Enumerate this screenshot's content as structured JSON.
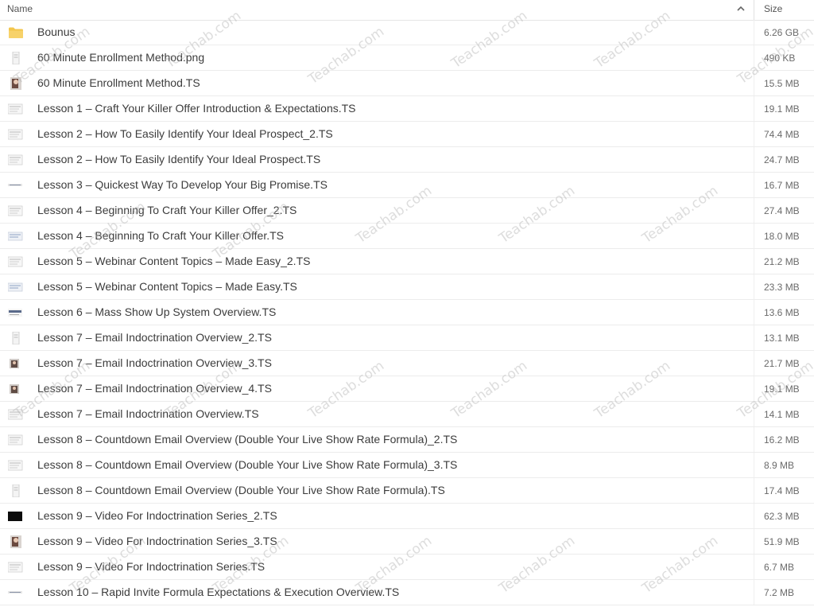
{
  "header": {
    "name_label": "Name",
    "size_label": "Size",
    "sort_icon": "chevron-up-icon"
  },
  "watermark": "Teachab.com",
  "files": [
    {
      "name": "Bounus",
      "size": "6.26 GB",
      "icon": "folder-icon",
      "kind": "folder"
    },
    {
      "name": "60 Minute Enrollment Method.png",
      "size": "490 KB",
      "icon": "image-thumb-icon",
      "kind": "doc-narrow"
    },
    {
      "name": "60 Minute Enrollment Method.TS",
      "size": "15.5 MB",
      "icon": "video-thumb-icon",
      "kind": "photo"
    },
    {
      "name": "Lesson 1 – Craft Your Killer Offer Introduction & Expectations.TS",
      "size": "19.1 MB",
      "icon": "video-thumb-icon",
      "kind": "slide"
    },
    {
      "name": "Lesson 2 – How To Easily Identify Your Ideal Prospect_2.TS",
      "size": "74.4 MB",
      "icon": "video-thumb-icon",
      "kind": "slide"
    },
    {
      "name": "Lesson 2 – How To Easily Identify Your Ideal Prospect.TS",
      "size": "24.7 MB",
      "icon": "video-thumb-icon",
      "kind": "slide"
    },
    {
      "name": "Lesson 3 – Quickest Way To Develop Your Big Promise.TS",
      "size": "16.7 MB",
      "icon": "video-thumb-icon",
      "kind": "line"
    },
    {
      "name": "Lesson 4 – Beginning To Craft Your Killer Offer_2.TS",
      "size": "27.4 MB",
      "icon": "video-thumb-icon",
      "kind": "slide"
    },
    {
      "name": "Lesson 4 – Beginning To Craft Your Killer Offer.TS",
      "size": "18.0 MB",
      "icon": "video-thumb-icon",
      "kind": "slide-blue"
    },
    {
      "name": "Lesson 5 – Webinar Content Topics – Made Easy_2.TS",
      "size": "21.2 MB",
      "icon": "video-thumb-icon",
      "kind": "slide"
    },
    {
      "name": "Lesson 5 – Webinar Content Topics – Made Easy.TS",
      "size": "23.3 MB",
      "icon": "video-thumb-icon",
      "kind": "slide-blue"
    },
    {
      "name": "Lesson 6 – Mass Show Up System Overview.TS",
      "size": "13.6 MB",
      "icon": "video-thumb-icon",
      "kind": "text"
    },
    {
      "name": "Lesson 7 – Email Indoctrination Overview_2.TS",
      "size": "13.1 MB",
      "icon": "video-thumb-icon",
      "kind": "doc-narrow"
    },
    {
      "name": "Lesson 7 – Email Indoctrination Overview_3.TS",
      "size": "21.7 MB",
      "icon": "video-thumb-icon",
      "kind": "photo-small"
    },
    {
      "name": "Lesson 7 – Email Indoctrination Overview_4.TS",
      "size": "19.1 MB",
      "icon": "video-thumb-icon",
      "kind": "photo-small"
    },
    {
      "name": "Lesson 7 – Email Indoctrination Overview.TS",
      "size": "14.1 MB",
      "icon": "video-thumb-icon",
      "kind": "slide"
    },
    {
      "name": "Lesson 8 – Countdown Email Overview (Double Your Live Show Rate Formula)_2.TS",
      "size": "16.2 MB",
      "icon": "video-thumb-icon",
      "kind": "slide"
    },
    {
      "name": "Lesson 8 – Countdown Email Overview (Double Your Live Show Rate Formula)_3.TS",
      "size": "8.9 MB",
      "icon": "video-thumb-icon",
      "kind": "slide"
    },
    {
      "name": "Lesson 8 – Countdown Email Overview (Double Your Live Show Rate Formula).TS",
      "size": "17.4 MB",
      "icon": "video-thumb-icon",
      "kind": "doc-narrow"
    },
    {
      "name": "Lesson 9 – Video For Indoctrination Series_2.TS",
      "size": "62.3 MB",
      "icon": "video-thumb-icon",
      "kind": "dark"
    },
    {
      "name": "Lesson 9 – Video For Indoctrination Series_3.TS",
      "size": "51.9 MB",
      "icon": "video-thumb-icon",
      "kind": "photo"
    },
    {
      "name": "Lesson 9 – Video For Indoctrination Series.TS",
      "size": "6.7 MB",
      "icon": "video-thumb-icon",
      "kind": "slide"
    },
    {
      "name": "Lesson 10 – Rapid Invite Formula Expectations & Execution Overview.TS",
      "size": "7.2 MB",
      "icon": "video-thumb-icon",
      "kind": "line"
    }
  ]
}
